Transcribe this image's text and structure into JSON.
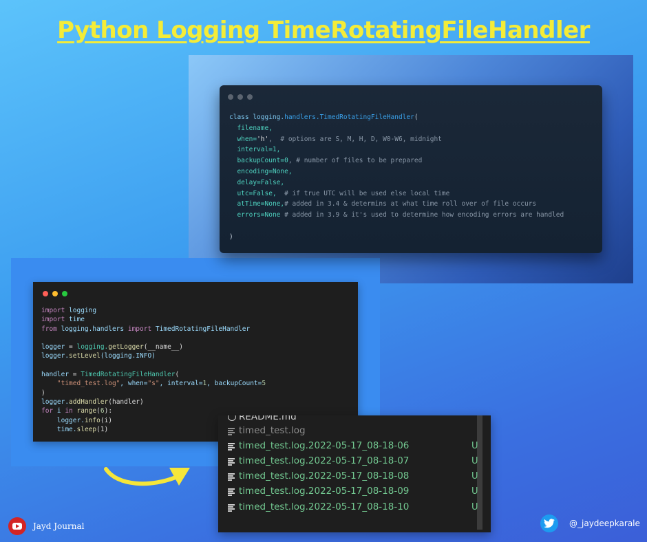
{
  "title": "Python Logging TimeRotatingFileHandler ",
  "signature_code": {
    "window_dots": [
      "#5b6470",
      "#5b6470",
      "#5b6470"
    ],
    "line1": {
      "kw": "class ",
      "mod": "logging.",
      "fn": "handlers.TimedRotatingFileHandler",
      "rest": "("
    },
    "line2": "filename,",
    "line3": {
      "arg": "when=",
      "val": "'h'",
      "comment": ",  # options are S, M, H, D, W0-W6, midnight"
    },
    "line4": {
      "arg": "interval=",
      "val": "1,"
    },
    "line5": {
      "arg": "backupCount=",
      "val": "0",
      "comment": ", # number of files to be prepared"
    },
    "line6": {
      "arg": "encoding=",
      "val": "None,"
    },
    "line7": {
      "arg": "delay=",
      "val": "False,"
    },
    "line8": {
      "arg": "utc=",
      "val": "False,",
      "comment": "  # if true UTC will be used else local time"
    },
    "line9": {
      "arg": "atTime=",
      "val": "None,",
      "comment": "# added in 3.4 & determins at what time roll over of file occurs"
    },
    "line10": {
      "arg": "errors=",
      "val": "None",
      "comment": " # added in 3.9 & it's used to determine how encoding errors are handled"
    },
    "line11": ")"
  },
  "example_code": {
    "window_dots": [
      "#ff5f56",
      "#ffbd2e",
      "#27c93f"
    ],
    "l1": {
      "kw": "import",
      "rest": " logging"
    },
    "l2": {
      "kw": "import",
      "rest": " time"
    },
    "l3": {
      "kw": "from",
      "mod": " logging.handlers ",
      "kw2": "import",
      "cls": " TimedRotatingFileHandler"
    },
    "l4": {
      "var": "logger",
      "eq": " = ",
      "mod": "logging.",
      "fn": "getLogger",
      "rest": "(__name__)"
    },
    "l5": {
      "var": "logger.",
      "fn": "setLevel",
      "rest": "(logging.INFO)"
    },
    "l6": {
      "var": "handler",
      "eq": " = ",
      "cls": "TimedRotatingFileHandler",
      "rest": "("
    },
    "l7": {
      "str": "\"timed_test.log\"",
      "a": ", when=",
      "str2": "\"s\"",
      "b": ", interval=",
      "n1": "1",
      "c": ", backupCount=",
      "n2": "5"
    },
    "l8": ")",
    "l9": {
      "var": "logger.",
      "fn": "addHandler",
      "rest": "(handler)"
    },
    "l10": {
      "kw": "for",
      "a": " i ",
      "kw2": "in",
      "fn": " range",
      "b": "(",
      "n": "6",
      "c": "):"
    },
    "l11": {
      "var": "logger.",
      "fn": "info",
      "rest": "(i)"
    },
    "l12": {
      "var": "time.",
      "fn": "sleep",
      "rest": "(1)"
    }
  },
  "explorer": {
    "items": [
      {
        "icon": "info-icon",
        "label": "README.md",
        "badge": "",
        "color": "#cccccc"
      },
      {
        "icon": "file-lines-icon",
        "label": "timed_test.log",
        "badge": "",
        "color": "#8c8c8c"
      },
      {
        "icon": "file-lines-icon",
        "label": "timed_test.log.2022-05-17_08-18-06",
        "badge": "U",
        "color": "#73c991"
      },
      {
        "icon": "file-lines-icon",
        "label": "timed_test.log.2022-05-17_08-18-07",
        "badge": "U",
        "color": "#73c991"
      },
      {
        "icon": "file-lines-icon",
        "label": "timed_test.log.2022-05-17_08-18-08",
        "badge": "U",
        "color": "#73c991"
      },
      {
        "icon": "file-lines-icon",
        "label": "timed_test.log.2022-05-17_08-18-09",
        "badge": "U",
        "color": "#73c991"
      },
      {
        "icon": "file-lines-icon",
        "label": "timed_test.log.2022-05-17_08-18-10",
        "badge": "U",
        "color": "#73c991"
      }
    ]
  },
  "footer": {
    "brand": "Jayd Journal",
    "brand_icon": "youtube-icon",
    "handle": "@_jaydeepkarale",
    "handle_icon": "twitter-icon"
  },
  "colors": {
    "title": "#f4ec38",
    "arrow": "#f5e63a"
  }
}
